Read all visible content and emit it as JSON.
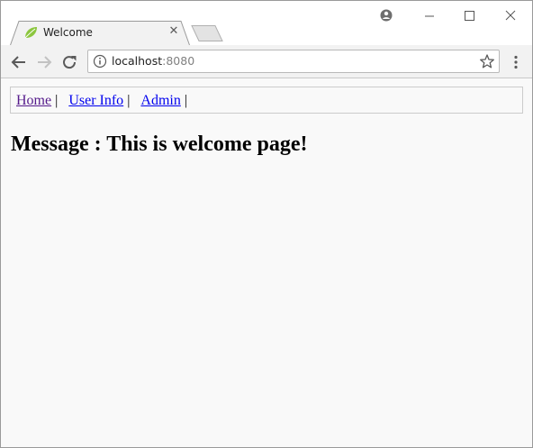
{
  "browser": {
    "tab": {
      "title": "Welcome",
      "favicon": "spring-leaf-icon",
      "close_label": "✕"
    },
    "new_tab": "new-tab-icon",
    "window_controls": [
      "profile-icon",
      "minimize-icon",
      "maximize-icon",
      "close-window-icon"
    ],
    "address_bar": {
      "host": "localhost",
      "port": ":8080"
    }
  },
  "page": {
    "nav_links": [
      {
        "label": "Home",
        "visited": true
      },
      {
        "label": "User Info",
        "visited": false
      },
      {
        "label": "Admin",
        "visited": false
      }
    ],
    "separator": "|",
    "heading": "Message : This is welcome page!"
  },
  "colors": {
    "link": "#0000ee",
    "visited_link": "#551a8b",
    "favicon_green": "#6db33f",
    "page_background": "#f9f9f9"
  }
}
